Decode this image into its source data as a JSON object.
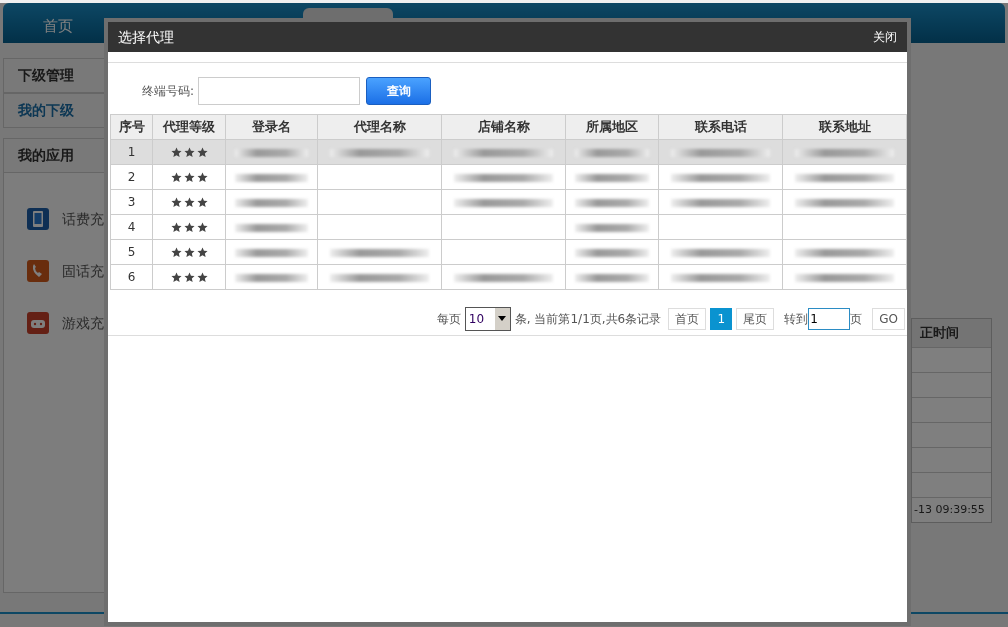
{
  "background": {
    "nav": {
      "home": "首页"
    },
    "sidebar": {
      "sections": [
        {
          "title": "下级管理",
          "active": false
        },
        {
          "title": "我的下级",
          "active": true
        },
        {
          "title": "我的应用",
          "active": false
        }
      ],
      "apps": [
        {
          "label": "话费充",
          "kind": "phone"
        },
        {
          "label": "固话充",
          "kind": "landline"
        },
        {
          "label": "游戏充",
          "kind": "game"
        }
      ]
    },
    "right_table": {
      "header": "正时间",
      "time": "-13 09:39:55"
    }
  },
  "dialog": {
    "title": "选择代理",
    "close": "关闭",
    "search": {
      "label": "终端号码:",
      "button": "查询"
    },
    "table": {
      "columns": [
        "序号",
        "代理等级",
        "登录名",
        "代理名称",
        "店铺名称",
        "所属地区",
        "联系电话",
        "联系地址"
      ],
      "rows": [
        {
          "number": "1",
          "stars": 3,
          "selected": true,
          "redacted": [
            true,
            true,
            true,
            true,
            true,
            true
          ]
        },
        {
          "number": "2",
          "stars": 3,
          "selected": false,
          "redacted": [
            true,
            false,
            true,
            true,
            true,
            true
          ]
        },
        {
          "number": "3",
          "stars": 3,
          "selected": false,
          "redacted": [
            true,
            false,
            true,
            true,
            true,
            true
          ]
        },
        {
          "number": "4",
          "stars": 3,
          "selected": false,
          "redacted": [
            true,
            false,
            false,
            true,
            false,
            false
          ]
        },
        {
          "number": "5",
          "stars": 3,
          "selected": false,
          "redacted": [
            true,
            true,
            false,
            true,
            true,
            true
          ]
        },
        {
          "number": "6",
          "stars": 3,
          "selected": false,
          "redacted": [
            true,
            true,
            true,
            true,
            true,
            true
          ]
        }
      ]
    },
    "pager": {
      "per_page_label": "每页",
      "per_page": "10",
      "summary": "条, 当前第1/1页,共6条记录",
      "first": "首页",
      "pages": [
        {
          "label": "1",
          "selected": true
        }
      ],
      "last": "尾页",
      "goto_label": "转到",
      "goto_value": "1",
      "page_unit": "页",
      "go": "GO"
    }
  }
}
